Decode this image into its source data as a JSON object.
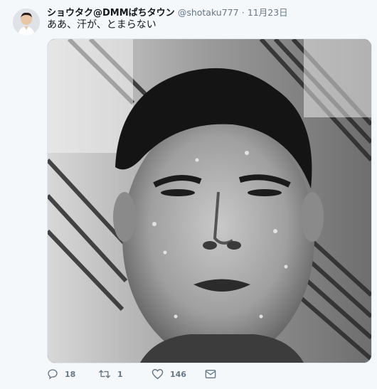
{
  "tweet": {
    "display_name": "ショウタク@DMMぱちタウン",
    "handle": "@shotaku777",
    "separator": "·",
    "timestamp": "11月23日",
    "text": "ああ、汗が、とまらない"
  },
  "actions": {
    "reply_count": "18",
    "retweet_count": "1",
    "like_count": "146"
  },
  "icons": {
    "reply": "speech-bubble-icon",
    "retweet": "retweet-arrows-icon",
    "like": "heart-icon",
    "dm": "envelope-icon"
  },
  "colors": {
    "background": "#f5f8fa",
    "text": "#14171a",
    "secondary": "#657786",
    "border": "#e1e8ed"
  }
}
